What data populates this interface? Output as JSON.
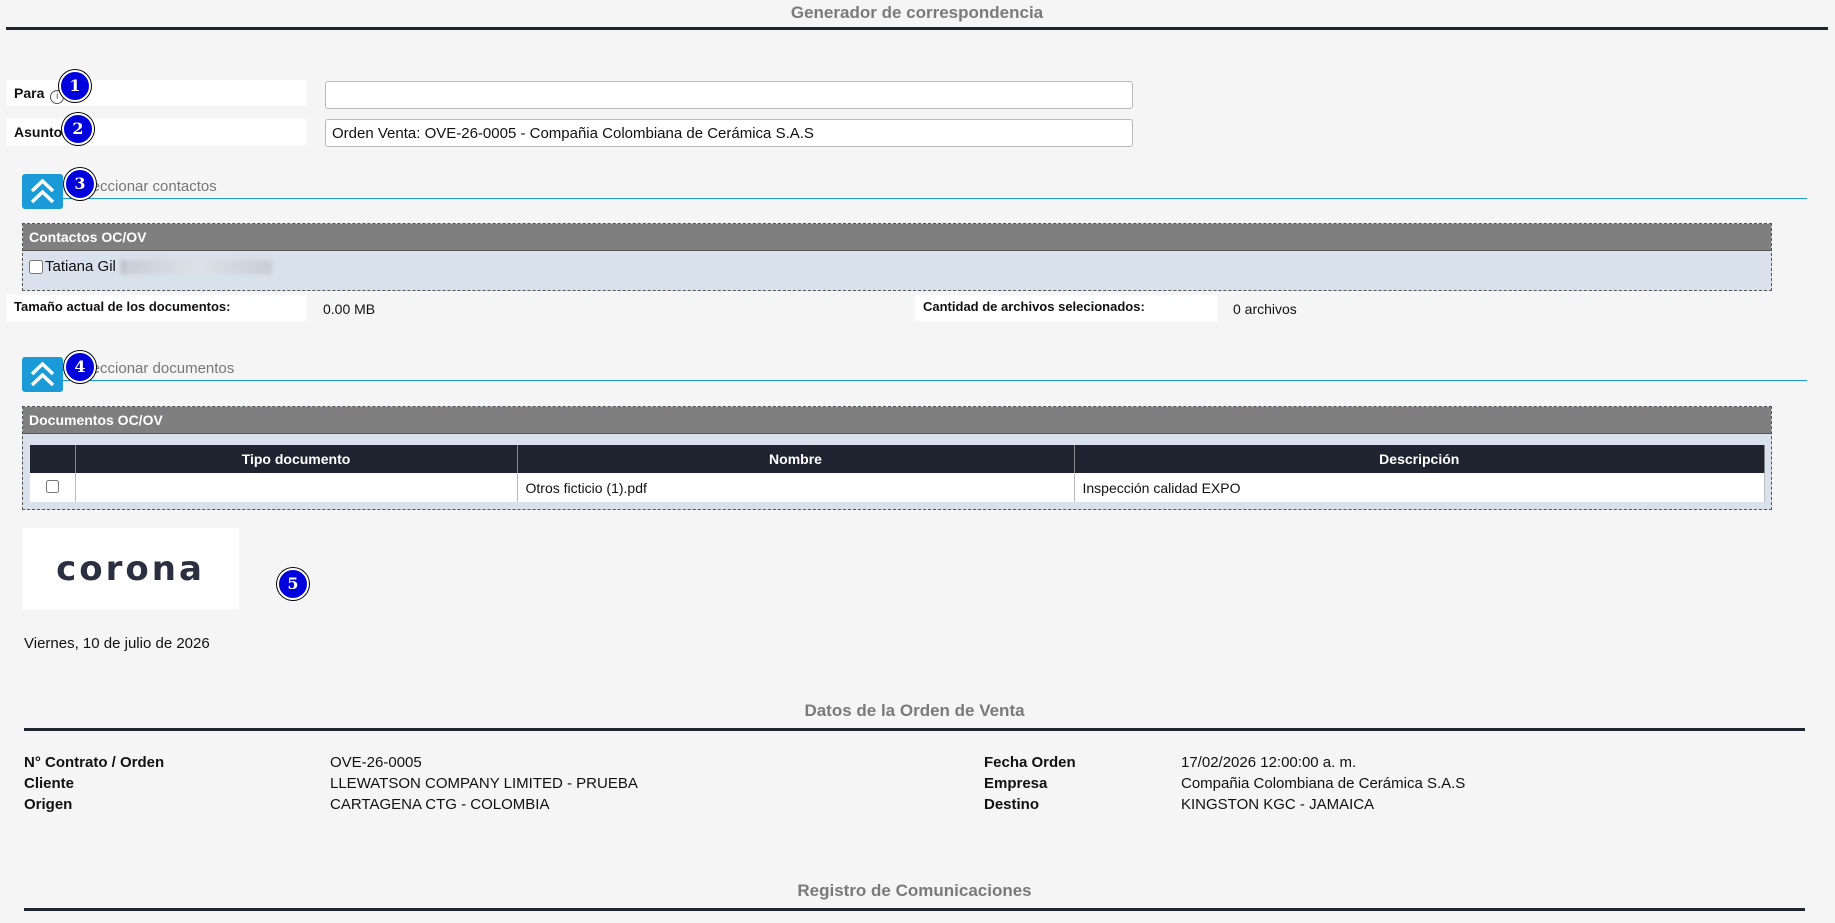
{
  "header": {
    "title": "Generador de correspondencia"
  },
  "form": {
    "para_label": "Para",
    "para_info": "i",
    "para_value": "",
    "asunto_label": "Asunto",
    "asunto_value": "Orden Venta: OVE-26-0005 - Compañia Colombiana de Cerámica S.A.S"
  },
  "badges": [
    "1",
    "2",
    "3",
    "4",
    "5"
  ],
  "contacts_section": {
    "toggle_label": "Seleccionar contactos",
    "panel_title": "Contactos OC/OV",
    "contacts": [
      {
        "name": "Tatiana Gil"
      }
    ]
  },
  "stats": {
    "size_label": "Tamaño actual de los documentos:",
    "size_value": "0.00 MB",
    "count_label": "Cantidad de archivos selecionados:",
    "count_value": "0 archivos"
  },
  "documents_section": {
    "toggle_label": "Seleccionar documentos",
    "panel_title": "Documentos OC/OV",
    "columns": [
      "Tipo documento",
      "Nombre",
      "Descripción"
    ],
    "rows": [
      {
        "tipo": "",
        "nombre": "Otros ficticio (1).pdf",
        "descripcion": "Inspección calidad EXPO"
      }
    ]
  },
  "logo": {
    "text": "corona"
  },
  "date_text": "Viernes, 10 de julio de 2026",
  "order_section": {
    "title": "Datos de la Orden de Venta",
    "left": [
      {
        "label": "N° Contrato / Orden",
        "value": "OVE-26-0005"
      },
      {
        "label": "Cliente",
        "value": "LLEWATSON COMPANY LIMITED - PRUEBA"
      },
      {
        "label": "Origen",
        "value": "CARTAGENA CTG - COLOMBIA"
      }
    ],
    "right": [
      {
        "label": "Fecha Orden",
        "value": "17/02/2026 12:00:00 a. m."
      },
      {
        "label": "Empresa",
        "value": "Compañia Colombiana de Cerámica S.A.S"
      },
      {
        "label": "Destino",
        "value": "KINGSTON KGC - JAMAICA"
      }
    ]
  },
  "comms_section": {
    "title": "Registro de Comunicaciones"
  },
  "colors": {
    "accent": "#1a9ad6",
    "panel_header": "#7f7f7f",
    "table_header": "#1f2430",
    "badge": "#0000dd"
  }
}
